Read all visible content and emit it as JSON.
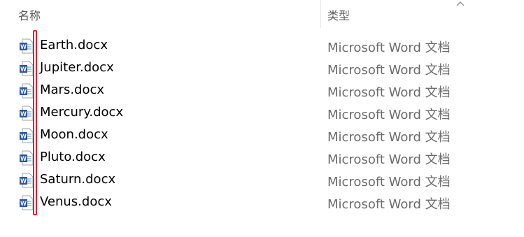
{
  "columns": {
    "name_header": "名称",
    "type_header": "类型"
  },
  "files": [
    {
      "name": "Earth.docx",
      "type": "Microsoft Word 文档",
      "icon": "word-document-icon"
    },
    {
      "name": "Jupiter.docx",
      "type": "Microsoft Word 文档",
      "icon": "word-document-icon"
    },
    {
      "name": "Mars.docx",
      "type": "Microsoft Word 文档",
      "icon": "word-document-icon"
    },
    {
      "name": "Mercury.docx",
      "type": "Microsoft Word 文档",
      "icon": "word-document-icon"
    },
    {
      "name": "Moon.docx",
      "type": "Microsoft Word 文档",
      "icon": "word-document-icon"
    },
    {
      "name": "Pluto.docx",
      "type": "Microsoft Word 文档",
      "icon": "word-document-icon"
    },
    {
      "name": "Saturn.docx",
      "type": "Microsoft Word 文档",
      "icon": "word-document-icon"
    },
    {
      "name": "Venus.docx",
      "type": "Microsoft Word 文档",
      "icon": "word-document-icon"
    }
  ],
  "colors": {
    "word_blue": "#2b5797",
    "highlight_red": "#e0202e"
  }
}
